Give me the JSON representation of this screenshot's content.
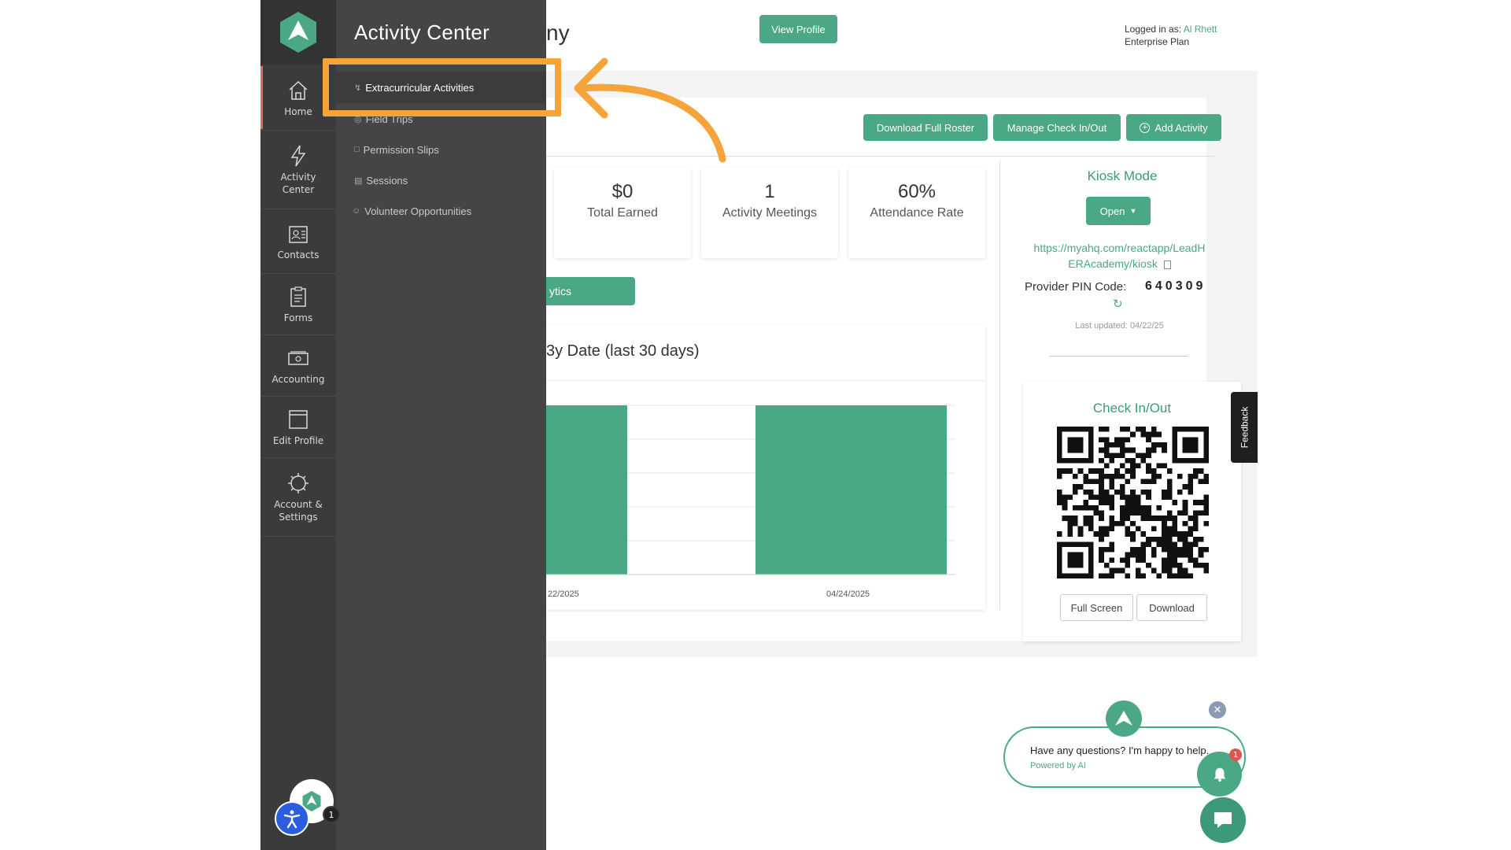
{
  "sidebar": {
    "items": [
      {
        "label": "Home",
        "icon": "home-icon"
      },
      {
        "label": "Activity Center",
        "icon": "lightning-icon"
      },
      {
        "label": "Contacts",
        "icon": "contacts-icon"
      },
      {
        "label": "Forms",
        "icon": "clipboard-icon"
      },
      {
        "label": "Accounting",
        "icon": "money-icon"
      },
      {
        "label": "Edit Profile",
        "icon": "window-icon"
      },
      {
        "label": "Account & Settings",
        "icon": "gear-icon"
      }
    ]
  },
  "flyout": {
    "title": "Activity Center",
    "items": [
      {
        "label": "Extracurricular Activities",
        "icon": "lightning-icon"
      },
      {
        "label": "Field Trips",
        "icon": "compass-icon"
      },
      {
        "label": "Permission Slips",
        "icon": "document-icon"
      },
      {
        "label": "Sessions",
        "icon": "list-icon"
      },
      {
        "label": "Volunteer Opportunities",
        "icon": "smile-icon"
      }
    ]
  },
  "header": {
    "title_fragment": "ny",
    "view_profile": "View Profile",
    "logged_in_prefix": "Logged in as:",
    "user_name": "Al Rhett",
    "plan": "Enterprise Plan"
  },
  "toolbar": {
    "download_roster": "Download Full Roster",
    "manage_checkin": "Manage Check In/Out",
    "add_activity": "Add Activity"
  },
  "stats": [
    {
      "value": "$0",
      "label": "Total Earned"
    },
    {
      "value": "1",
      "label": "Activity Meetings"
    },
    {
      "value": "60%",
      "label": "Attendance Rate"
    }
  ],
  "analytics_button": "ytics",
  "chart": {
    "title": "3y Date (last 30 days)",
    "x_labels": [
      "22/2025",
      "04/24/2025"
    ]
  },
  "chart_data": {
    "type": "bar",
    "title": "3y Date (last 30 days)",
    "categories": [
      "22/2025",
      "04/24/2025"
    ],
    "values": [
      5,
      5
    ],
    "ylim": [
      0,
      5
    ],
    "grid": true,
    "color": "#4aa885"
  },
  "kiosk": {
    "title": "Kiosk Mode",
    "open_button": "Open",
    "url_line1": "https://myahq.com/reactapp/LeadH",
    "url_line2": "ERAcademy/kiosk",
    "pin_label": "Provider PIN Code:",
    "pin_value": "640309",
    "last_updated": "Last updated: 04/22/25"
  },
  "checkin": {
    "title": "Check In/Out",
    "full_screen": "Full Screen",
    "download": "Download"
  },
  "feedback": "Feedback",
  "chat": {
    "question": "Have any questions? I'm happy to help.",
    "powered": "Powered by AI",
    "notification_count": "1"
  },
  "user_badge": "1",
  "colors": {
    "accent": "#4aa885",
    "highlight": "#f5a43b",
    "rail": "#3b3b3b",
    "flyout": "#454545"
  }
}
